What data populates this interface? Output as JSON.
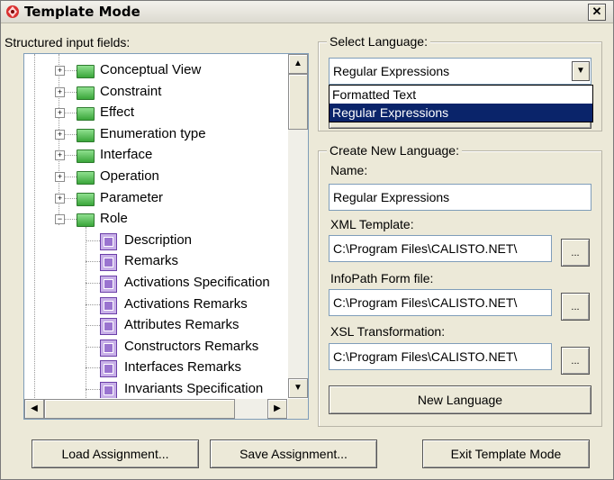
{
  "window": {
    "title": "Template Mode",
    "close_symbol": "✕"
  },
  "left": {
    "label": "Structured input fields:",
    "tree_items": [
      {
        "label": "Conceptual View",
        "type": "folder",
        "expander": "+"
      },
      {
        "label": "Constraint",
        "type": "folder",
        "expander": "+"
      },
      {
        "label": "Effect",
        "type": "folder",
        "expander": "+"
      },
      {
        "label": "Enumeration type",
        "type": "folder",
        "expander": "+"
      },
      {
        "label": "Interface",
        "type": "folder",
        "expander": "+"
      },
      {
        "label": "Operation",
        "type": "folder",
        "expander": "+"
      },
      {
        "label": "Parameter",
        "type": "folder",
        "expander": "+"
      },
      {
        "label": "Role",
        "type": "folder",
        "expander": "−"
      },
      {
        "label": "Description",
        "type": "field"
      },
      {
        "label": "Remarks",
        "type": "field"
      },
      {
        "label": "Activations Specification",
        "type": "field"
      },
      {
        "label": "Activations Remarks",
        "type": "field"
      },
      {
        "label": "Attributes Remarks",
        "type": "field"
      },
      {
        "label": "Constructors Remarks",
        "type": "field"
      },
      {
        "label": "Interfaces Remarks",
        "type": "field"
      },
      {
        "label": "Invariants Specification",
        "type": "field"
      }
    ]
  },
  "select_language": {
    "group_label": "Select Language:",
    "selected": "Regular Expressions",
    "options": [
      "Formatted Text",
      "Regular Expressions"
    ]
  },
  "create_language": {
    "group_label": "Create New Language:",
    "name_label": "Name:",
    "name_value": "Regular Expressions",
    "xml_label": "XML Template:",
    "xml_value": "C:\\Program Files\\CALISTO.NET\\",
    "infopath_label": "InfoPath Form file:",
    "infopath_value": "C:\\Program Files\\CALISTO.NET\\",
    "xsl_label": "XSL Transformation:",
    "xsl_value": "C:\\Program Files\\CALISTO.NET\\",
    "browse_label": "...",
    "new_button": "New Language"
  },
  "footer": {
    "load": "Load Assignment...",
    "save": "Save Assignment...",
    "exit": "Exit Template Mode"
  },
  "icons": {
    "app": "template-mode-app-icon",
    "folder": "folder-icon",
    "field": "field-doc-icon"
  }
}
